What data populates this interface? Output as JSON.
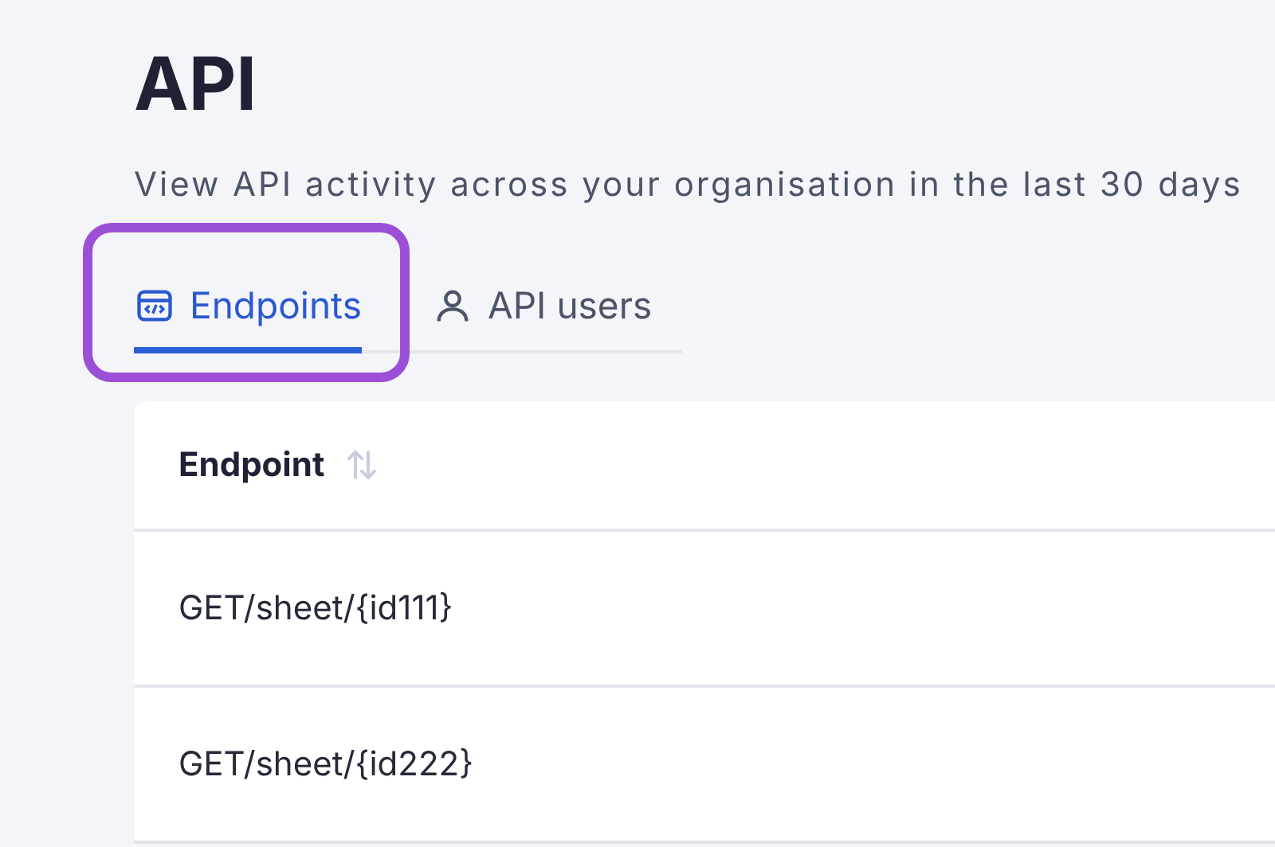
{
  "page": {
    "title": "API",
    "subtitle": "View API activity across your organisation in the last 30 days"
  },
  "tabs": [
    {
      "label": "Endpoints",
      "kind": "code",
      "selected": true,
      "highlighted": true
    },
    {
      "label": "API users",
      "kind": "user",
      "selected": false,
      "highlighted": false
    }
  ],
  "table": {
    "columns": [
      {
        "label": "Endpoint",
        "sortable": true
      }
    ],
    "rows": [
      {
        "endpoint": "GET/sheet/{id111}"
      },
      {
        "endpoint": "GET/sheet/{id222}"
      }
    ]
  }
}
